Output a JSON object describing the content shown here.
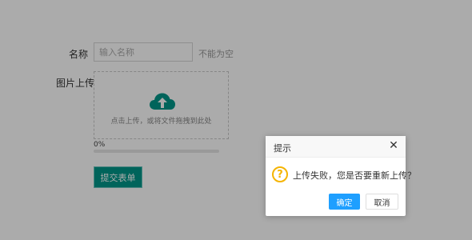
{
  "form": {
    "name_label": "名称",
    "name_placeholder": "输入名称",
    "name_hint": "不能为空",
    "image_label": "图片上传",
    "upload_text": "点击上传，或将文件拖拽到此处",
    "upload_icon": "cloud-upload-icon",
    "progress_text": "0%",
    "progress_value": 0,
    "submit_label": "提交表单"
  },
  "dialog": {
    "title": "提示",
    "close_glyph": "✕",
    "icon": "question-icon",
    "icon_glyph": "?",
    "message": "上传失败，您是否要重新上传？",
    "ok_label": "确定",
    "cancel_label": "取消"
  },
  "colors": {
    "primary": "#009688",
    "dialog_ok": "#1e9fff",
    "question_icon": "#f5b400",
    "overlay": "rgba(0,0,0,0.33)"
  }
}
